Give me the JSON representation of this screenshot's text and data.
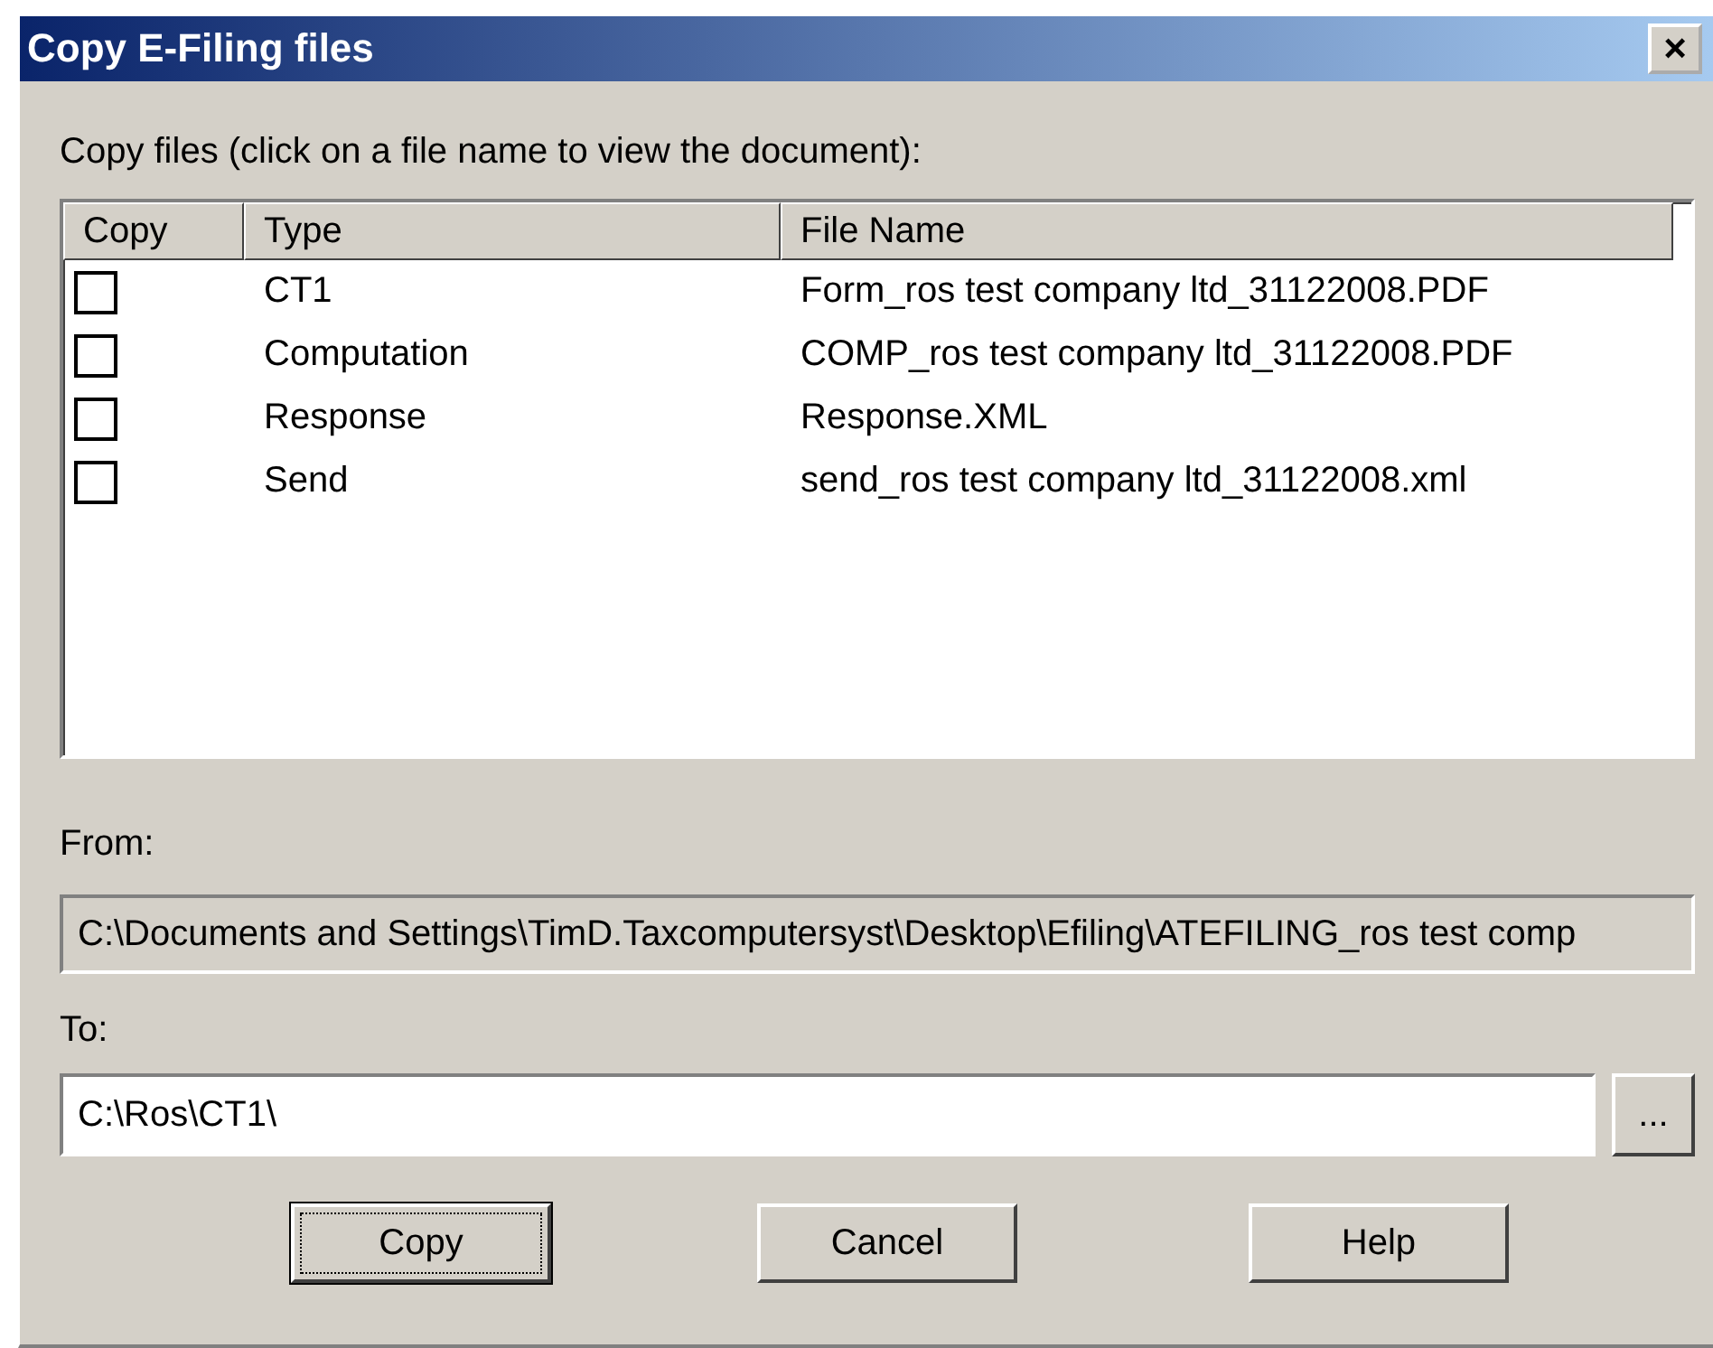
{
  "window": {
    "title": "Copy E-Filing files",
    "close": "×"
  },
  "instruction": "Copy files (click on a file name to view the document):",
  "table": {
    "columns": [
      "Copy",
      "Type",
      "File Name"
    ],
    "rows": [
      {
        "checked": false,
        "type": "CT1",
        "file_name": "Form_ros test company ltd_31122008.PDF"
      },
      {
        "checked": false,
        "type": "Computation",
        "file_name": "COMP_ros test company ltd_31122008.PDF"
      },
      {
        "checked": false,
        "type": "Response",
        "file_name": "Response.XML"
      },
      {
        "checked": false,
        "type": "Send",
        "file_name": "send_ros test company ltd_31122008.xml"
      }
    ]
  },
  "from": {
    "label": "From:",
    "value": "C:\\Documents and Settings\\TimD.Taxcomputersyst\\Desktop\\Efiling\\ATEFILING_ros test comp",
    "disabled": true
  },
  "to": {
    "label": "To:",
    "value": "C:\\Ros\\CT1\\",
    "browse": "..."
  },
  "buttons": [
    {
      "label": "Copy",
      "focused": true
    },
    {
      "label": "Cancel",
      "focused": false
    },
    {
      "label": "Help",
      "focused": false
    }
  ]
}
